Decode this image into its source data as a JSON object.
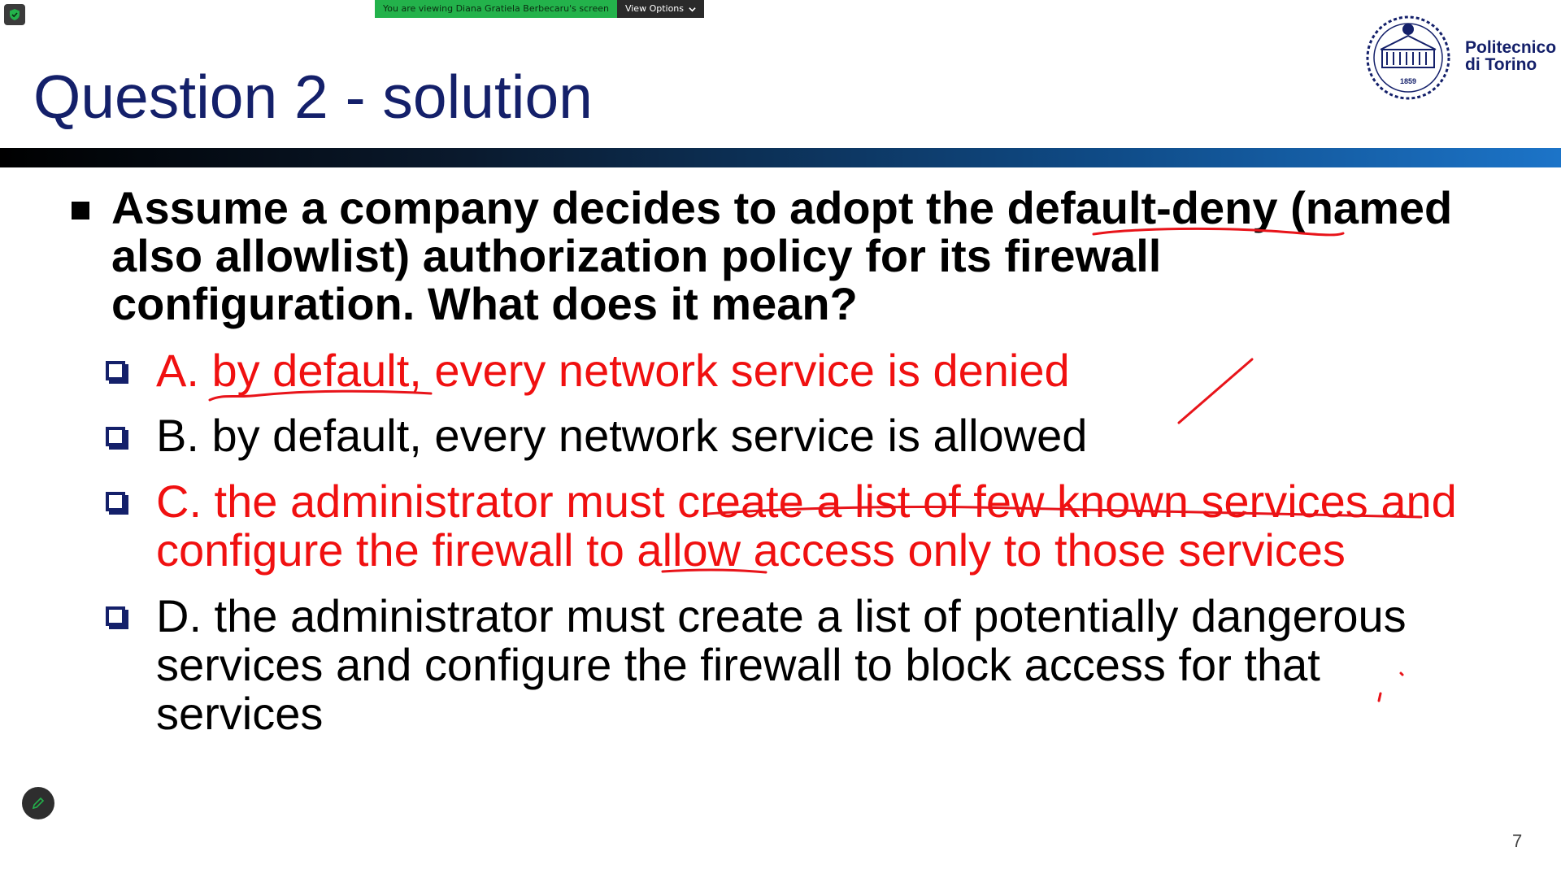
{
  "share_banner": {
    "viewing_text": "You are viewing Diana Gratiela Berbecaru's screen",
    "view_options_label": "View Options"
  },
  "slide": {
    "title": "Question 2 - solution",
    "logo": {
      "line1": "Politecnico",
      "line2": "di Torino",
      "year": "1859"
    },
    "question_lines": [
      "Assume a company decides to adopt the default-deny (named",
      "also allowlist) authorization policy for its firewall",
      "configuration. What does it mean?"
    ],
    "options": [
      {
        "lines": [
          "A. by default, every network service is denied"
        ],
        "highlight": true
      },
      {
        "lines": [
          "B. by default, every network service is allowed"
        ],
        "highlight": false
      },
      {
        "lines": [
          "C. the administrator must create a list of few known services and",
          "configure the firewall to allow access only to those services"
        ],
        "highlight": true
      },
      {
        "lines": [
          "D. the administrator must create a list of potentially dangerous",
          "services and configure the firewall to block access for that",
          "services"
        ],
        "highlight": false
      }
    ],
    "page_number": "7"
  },
  "colors": {
    "title": "#14206a",
    "answer_red": "#f01010",
    "annotation_red": "#e8141a",
    "banner_green": "#23b24b"
  },
  "icons": {
    "security": "shield-check-icon",
    "chevron": "chevron-down-icon",
    "annotate": "pencil-icon"
  }
}
